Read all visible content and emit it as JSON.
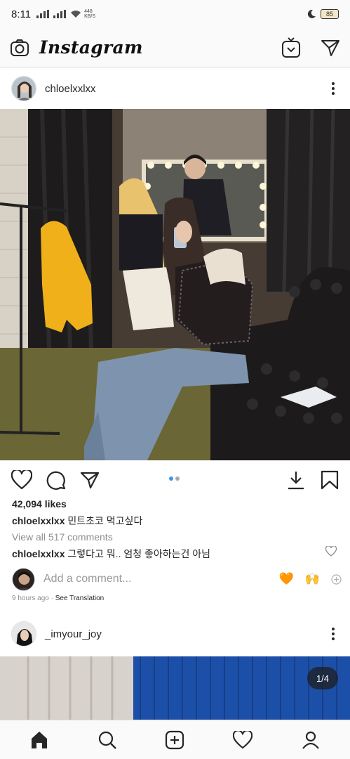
{
  "status_bar": {
    "time": "8:11",
    "net_speed_value": "448",
    "net_speed_unit": "KB/S",
    "battery": "85"
  },
  "app": {
    "title": "Instagram"
  },
  "post1": {
    "username": "chloelxxlxx",
    "likes": "42,094 likes",
    "caption_user": "chloelxxlxx",
    "caption_text": "민트초코 먹고싶다",
    "view_comments": "View all 517 comments",
    "comment_user": "chloelxxlxx",
    "comment_text": "그렇다고 뭐.. 엄청 좋아하는건 아님",
    "add_comment_placeholder": "Add a comment...",
    "quick_emojis": [
      "🧡",
      "🙌"
    ],
    "timestamp": "9 hours ago",
    "translate": "See Translation",
    "carousel_total": 2,
    "carousel_active": 1
  },
  "post2": {
    "username": "_imyour_joy",
    "counter": "1/4"
  },
  "colors": {
    "accent_dot": "#3897f0",
    "inactive_dot": "#a8a8a8",
    "icon": "#262626",
    "muted": "#8e8e8e"
  },
  "bottom_nav": [
    "home-icon",
    "search-icon",
    "new-post-icon",
    "activity-heart-icon",
    "profile-icon"
  ]
}
